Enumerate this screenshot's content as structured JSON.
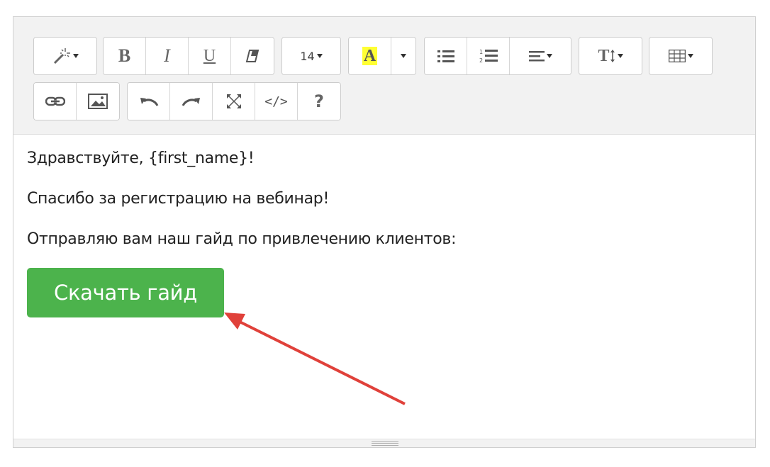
{
  "toolbar": {
    "font_size": "14",
    "help_label": "?",
    "code_label": "</>",
    "bold_label": "B",
    "italic_label": "I",
    "underline_label": "U",
    "font_color_label": "A",
    "text_height_label": "T"
  },
  "content": {
    "greeting": "Здравствуйте, {first_name}!",
    "line2": "Спасибо за регистрацию на вебинар!",
    "line3": "Отправляю вам наш гайд по привлечению клиентов:",
    "cta_label": "Скачать гайд"
  },
  "colors": {
    "cta": "#4cb34c",
    "arrow": "#e0413a",
    "highlight": "#ffff33"
  }
}
